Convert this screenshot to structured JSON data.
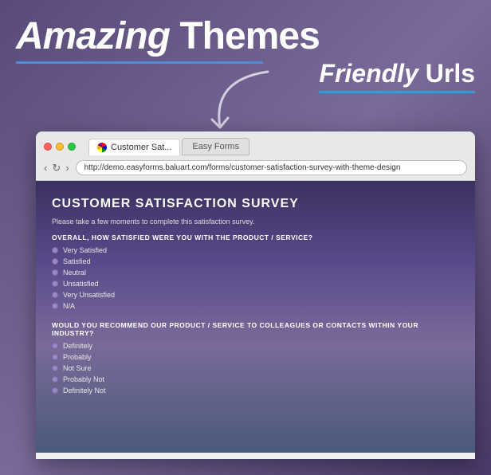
{
  "header": {
    "title_bold": "Amazing",
    "title_normal": " Themes",
    "friendly_bold": "Friendly",
    "friendly_normal": " Urls"
  },
  "browser": {
    "tab_active": "Customer Sat...",
    "tab_inactive": "Easy Forms",
    "address": "http://demo.easyforms.baluart.com/forms/customer-satisfaction-survey-with-theme-design"
  },
  "survey": {
    "title": "CUSTOMER SATISFACTION SURVEY",
    "subtitle": "Please take a few moments to complete this satisfaction survey.",
    "question1": "OVERALL, HOW SATISFIED WERE YOU WITH THE PRODUCT / SERVICE?",
    "options1": [
      "Very Satisfied",
      "Satisfied",
      "Neutral",
      "Unsatisfied",
      "Very Unsatisfied",
      "N/A"
    ],
    "question2": "WOULD YOU RECOMMEND OUR PRODUCT / SERVICE TO COLLEAGUES OR CONTACTS WITHIN YOUR INDUSTRY?",
    "options2": [
      "Definitely",
      "Probably",
      "Not Sure",
      "Probably Not",
      "Definitely Not"
    ]
  },
  "nav": {
    "back": "‹",
    "reload": "↻",
    "forward": "›"
  }
}
